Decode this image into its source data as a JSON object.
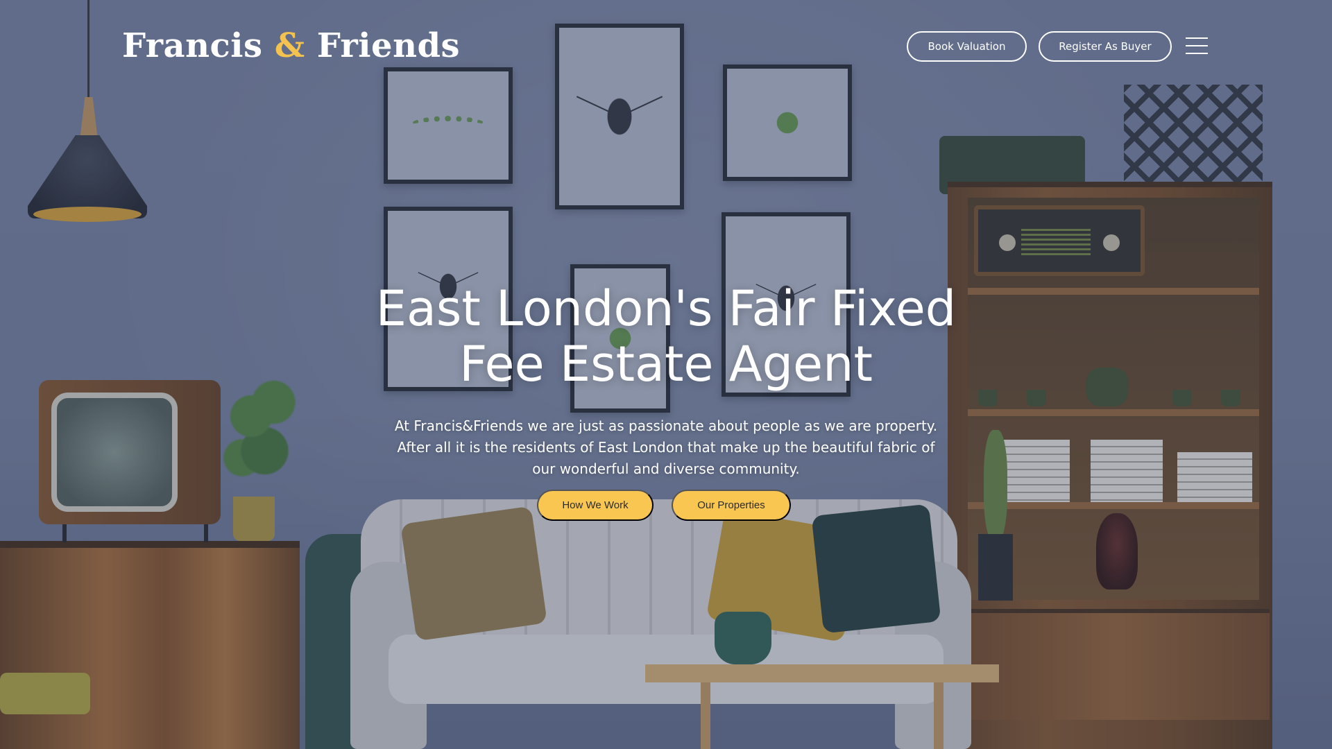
{
  "header": {
    "logo_first": "Francis ",
    "logo_amp": "&",
    "logo_second": " Friends",
    "book_valuation": "Book Valuation",
    "register_buyer": "Register As Buyer",
    "menu_icon": "hamburger-menu-icon"
  },
  "hero": {
    "title_line1": "East London's Fair Fixed",
    "title_line2": "Fee Estate Agent",
    "description": "At Francis&Friends we are just as passionate about people as we are property. After all it is the residents of East London that make up the beautiful fabric of our wonderful and diverse community.",
    "button_how": "How We Work",
    "button_properties": "Our Properties"
  },
  "colors": {
    "accent": "#f9c652",
    "logo_amp": "#f4c24e",
    "text": "#ffffff"
  }
}
